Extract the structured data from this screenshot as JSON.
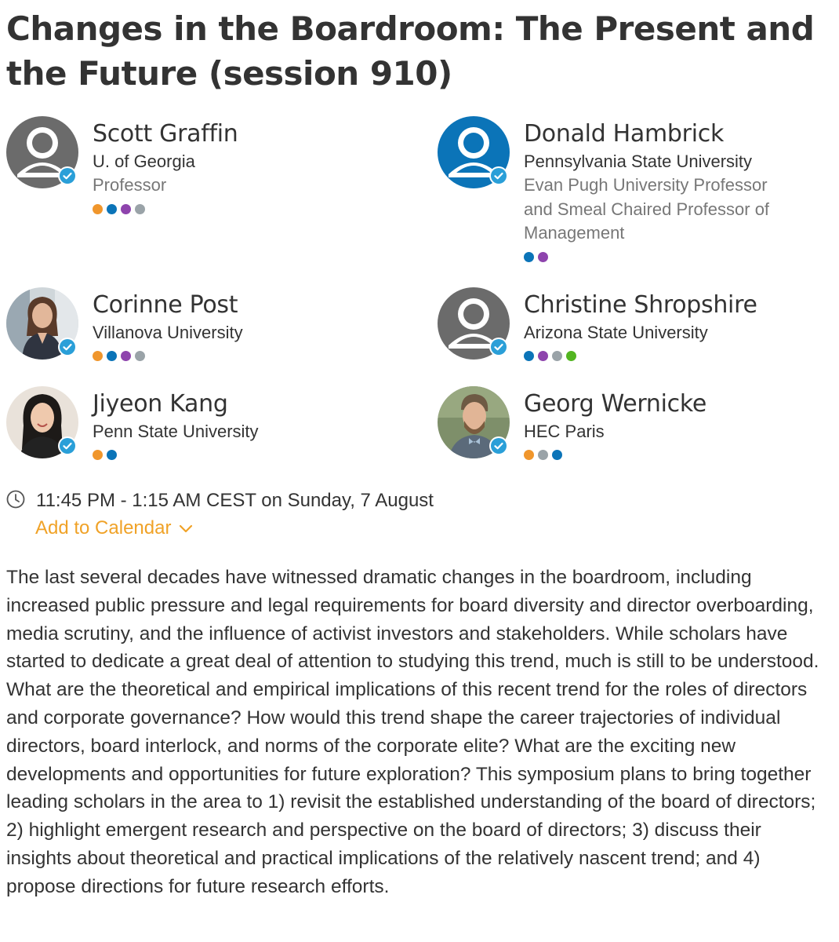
{
  "session": {
    "title": "Changes in the Boardroom: The Present and the Future (session 910)"
  },
  "speakers": [
    {
      "name": "Scott Graffin",
      "affiliation": "U. of Georgia",
      "role": "Professor",
      "avatar": "placeholder-gray-avatar",
      "dots": [
        "#f0962c",
        "#0b74b8",
        "#8e44ad",
        "#9aa3a8"
      ]
    },
    {
      "name": "Donald Hambrick",
      "affiliation": "Pennsylvania State University",
      "role": "Evan Pugh University Professor and Smeal Chaired Professor of Management",
      "avatar": "placeholder-blue-avatar",
      "dots": [
        "#0b74b8",
        "#8e44ad"
      ]
    },
    {
      "name": "Corinne Post",
      "affiliation": "Villanova University",
      "role": "",
      "avatar": "photo-avatar",
      "dots": [
        "#f0962c",
        "#0b74b8",
        "#8e44ad",
        "#9aa3a8"
      ]
    },
    {
      "name": "Christine Shropshire",
      "affiliation": "Arizona State University",
      "role": "",
      "avatar": "placeholder-gray-avatar",
      "dots": [
        "#0b74b8",
        "#8e44ad",
        "#9aa3a8",
        "#52b520"
      ]
    },
    {
      "name": "Jiyeon Kang",
      "affiliation": "Penn State University",
      "role": "",
      "avatar": "photo-avatar",
      "dots": [
        "#f0962c",
        "#0b74b8"
      ]
    },
    {
      "name": "Georg Wernicke",
      "affiliation": "HEC Paris",
      "role": "",
      "avatar": "photo-avatar",
      "dots": [
        "#f0962c",
        "#9aa3a8",
        "#0b74b8"
      ]
    }
  ],
  "schedule": {
    "time": "11:45 PM - 1:15 AM CEST on Sunday, 7 August",
    "clock_icon": "clock-icon",
    "add_to_calendar": "Add to Calendar",
    "chevron_icon": "chevron-down-icon"
  },
  "colors": {
    "accent": "#f0a227",
    "verified": "#2a9fd8",
    "avatar_gray": "#6b6b6b",
    "avatar_blue": "#0b74b8"
  },
  "description": "The last several decades have witnessed dramatic changes in the boardroom, including increased public pressure and legal requirements for board diversity and director overboarding, media scrutiny, and the influence of activist investors and stakeholders. While scholars have started to dedicate a great deal of attention to studying this trend, much is still to be understood. What are the theoretical and empirical implications of this recent trend for the roles of directors and corporate governance? How would this trend shape the career trajectories of individual directors, board interlock, and norms of the corporate elite? What are the exciting new developments and opportunities for future exploration? This symposium plans to bring together leading scholars in the area to 1) revisit the established understanding of the board of directors; 2) highlight emergent research and perspective on the board of directors; 3) discuss their insights about theoretical and practical implications of the relatively nascent trend; and 4) propose directions for future research efforts."
}
